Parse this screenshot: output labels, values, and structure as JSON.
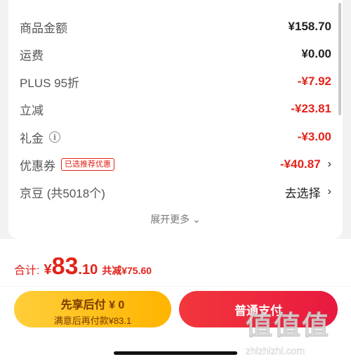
{
  "order_summary": {
    "rows": [
      {
        "label": "商品金额",
        "value": "¥158.70"
      },
      {
        "label": "运费",
        "value": "¥0.00"
      },
      {
        "label": "PLUS 95折",
        "value": "-¥7.92"
      },
      {
        "label": "立减",
        "value": "-¥23.81"
      },
      {
        "label": "礼金",
        "value": "-¥3.00"
      },
      {
        "label": "优惠券",
        "badge": "已选推荐优惠",
        "value": "-¥40.87"
      },
      {
        "label": "京豆 (共5018个)",
        "value": "去选择"
      }
    ],
    "expand_more": "展开更多",
    "expand_chevron": "⌄"
  },
  "footer": {
    "total_label": "合计:",
    "total_yen": "¥",
    "total_int": "83",
    "total_dec": ".10",
    "total_saved": "共减¥75.60",
    "later_line1": "先享后付 ¥ 0",
    "later_line2": "满意后再付款¥83.1",
    "pay_label": "普通支付"
  },
  "watermark": {
    "logo_text": "值值值",
    "url": "zhizhizhi.com"
  },
  "colors": {
    "accent_red": "#e2231a",
    "yellow_button": "#ffb400",
    "pay_button": "#e8193f"
  },
  "icons": {
    "info": "info-icon",
    "chevron_right": "chevron-right-icon",
    "chevron_down": "chevron-down-icon"
  }
}
